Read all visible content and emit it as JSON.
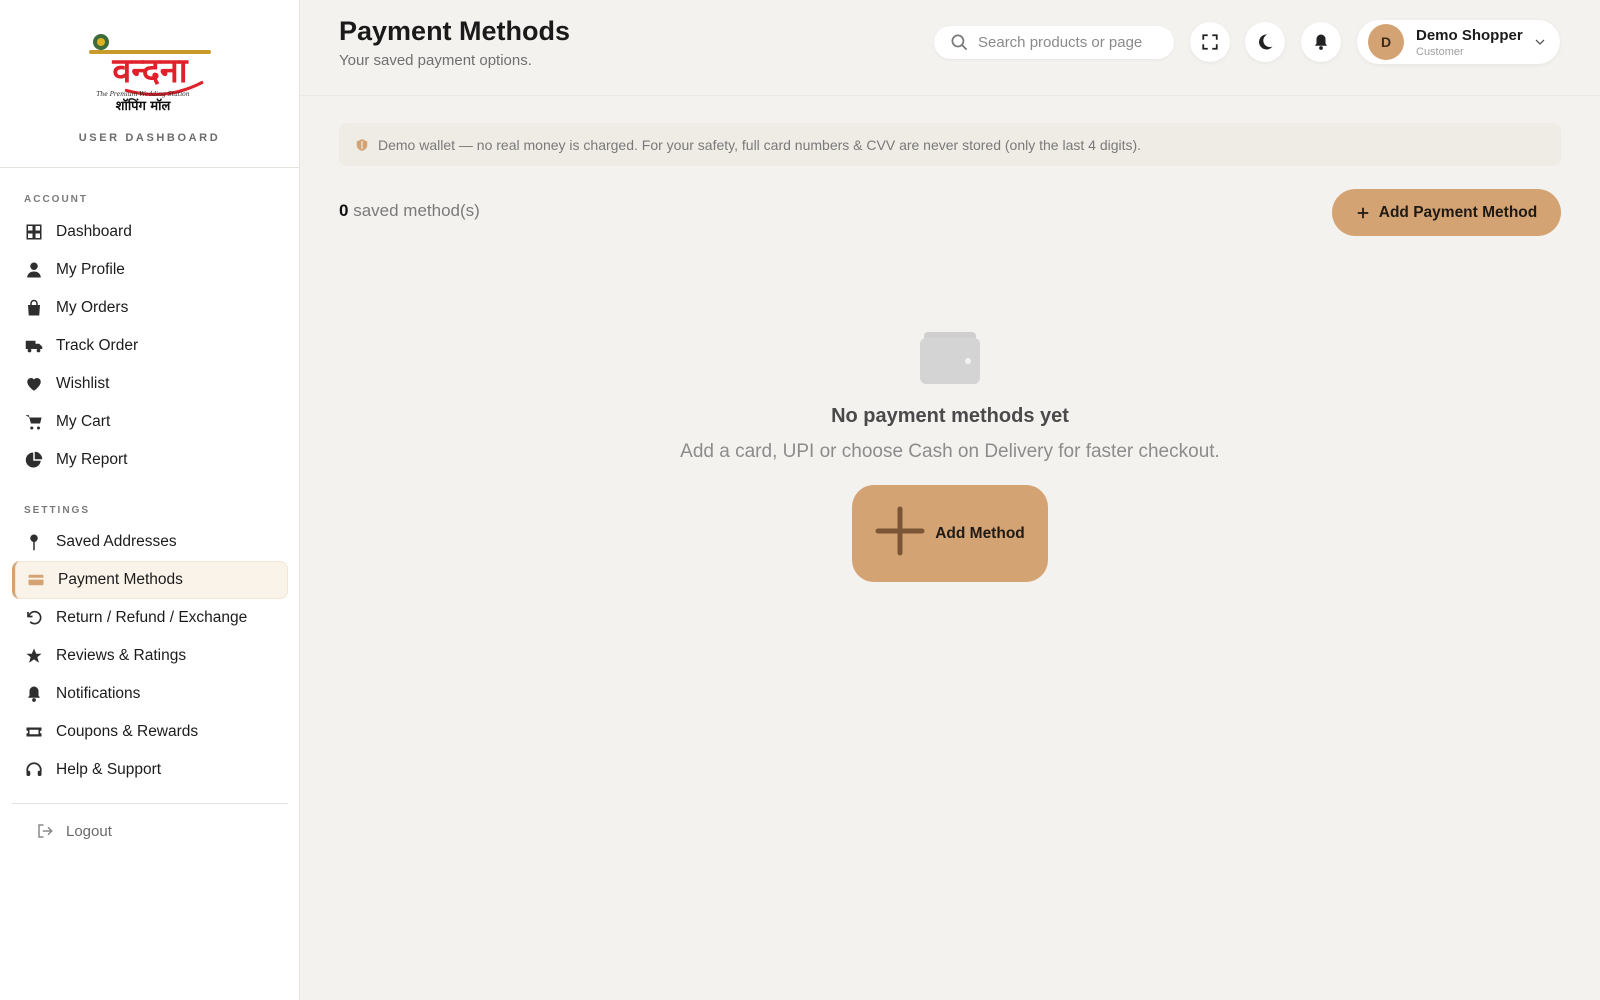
{
  "sidebar": {
    "logo_text": "वन्दना",
    "logo_tagline": "The Premium Wedding Station",
    "logo_subtext": "शॉपिंग मॉल",
    "dashboard_label": "USER DASHBOARD",
    "account_label": "ACCOUNT",
    "settings_label": "SETTINGS",
    "account_items": [
      {
        "label": "Dashboard",
        "icon": "grid-icon"
      },
      {
        "label": "My Profile",
        "icon": "user-icon"
      },
      {
        "label": "My Orders",
        "icon": "bag-icon"
      },
      {
        "label": "Track Order",
        "icon": "truck-icon"
      },
      {
        "label": "Wishlist",
        "icon": "heart-icon"
      },
      {
        "label": "My Cart",
        "icon": "cart-icon"
      },
      {
        "label": "My Report",
        "icon": "pie-chart-icon"
      }
    ],
    "settings_items": [
      {
        "label": "Saved Addresses",
        "icon": "pin-icon"
      },
      {
        "label": "Payment Methods",
        "icon": "credit-card-icon",
        "active": true
      },
      {
        "label": "Return / Refund / Exchange",
        "icon": "undo-icon"
      },
      {
        "label": "Reviews & Ratings",
        "icon": "star-icon"
      },
      {
        "label": "Notifications",
        "icon": "bell-icon"
      },
      {
        "label": "Coupons & Rewards",
        "icon": "ticket-icon"
      },
      {
        "label": "Help & Support",
        "icon": "headset-icon"
      }
    ],
    "logout_label": "Logout"
  },
  "header": {
    "title": "Payment Methods",
    "subtitle": "Your saved payment options.",
    "search_placeholder": "Search products or page",
    "user_initial": "D",
    "user_name": "Demo Shopper",
    "user_role": "Customer"
  },
  "notice": {
    "text": "Demo wallet — no real money is charged. For your safety, full card numbers & CVV are never stored (only the last 4 digits)."
  },
  "summary": {
    "count": "0",
    "count_suffix": "saved method(s)",
    "add_button": "Add Payment Method"
  },
  "empty_state": {
    "title": "No payment methods yet",
    "subtitle": "Add a card, UPI or choose Cash on Delivery for faster checkout.",
    "button": "Add Method"
  },
  "colors": {
    "accent": "#d4a373",
    "background": "#f4f2ef",
    "sidebar_bg": "#ffffff",
    "logo_red": "#e0202a"
  }
}
